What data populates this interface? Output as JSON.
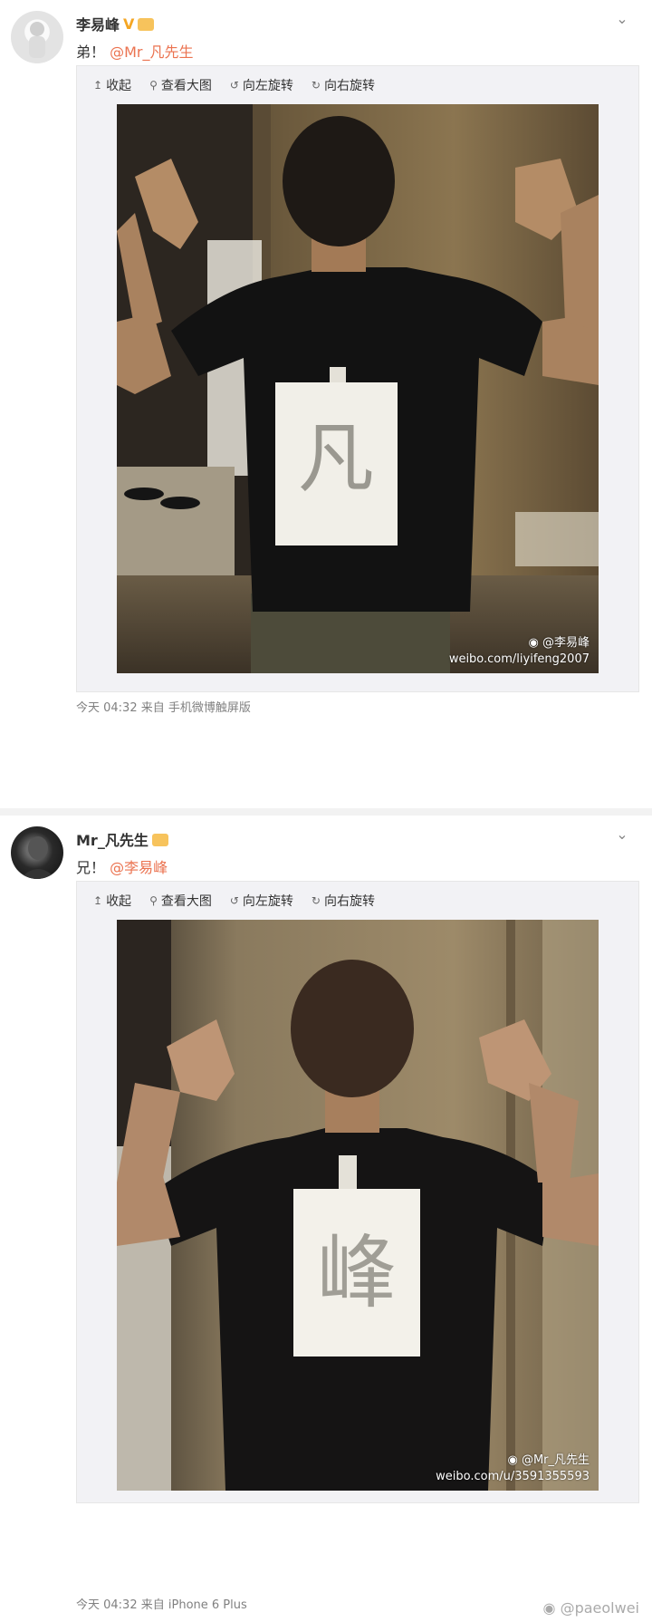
{
  "posts": [
    {
      "author": "李易峰",
      "verified_mark": "V",
      "text_prefix": "弟！",
      "mention": "@Mr_凡先生",
      "toolbar": {
        "collapse": "收起",
        "view_large": "查看大图",
        "rotate_left": "向左旋转",
        "rotate_right": "向右旋转"
      },
      "paper_glyph": "凡",
      "watermark_handle": "@李易峰",
      "watermark_url": "weibo.com/liyifeng2007",
      "timestamp": "今天 04:32",
      "source": "来自 手机微博触屏版"
    },
    {
      "author": "Mr_凡先生",
      "text_prefix": "兄！",
      "mention": "@李易峰",
      "toolbar": {
        "collapse": "收起",
        "view_large": "查看大图",
        "rotate_left": "向左旋转",
        "rotate_right": "向右旋转"
      },
      "paper_glyph": "峰",
      "watermark_handle": "@Mr_凡先生",
      "watermark_url": "weibo.com/u/3591355593",
      "timestamp": "今天 04:32",
      "source": "来自 iPhone 6 Plus"
    }
  ],
  "corner_watermark": "@paeolwei",
  "icons": [
    "chevron-down-icon",
    "collapse-icon",
    "zoom-icon",
    "rotate-left-icon",
    "rotate-right-icon",
    "weibo-logo-icon"
  ],
  "colors": {
    "mention": "#eb7350",
    "badge": "#f5a623",
    "meta": "#808080",
    "panel": "#f2f2f5"
  }
}
